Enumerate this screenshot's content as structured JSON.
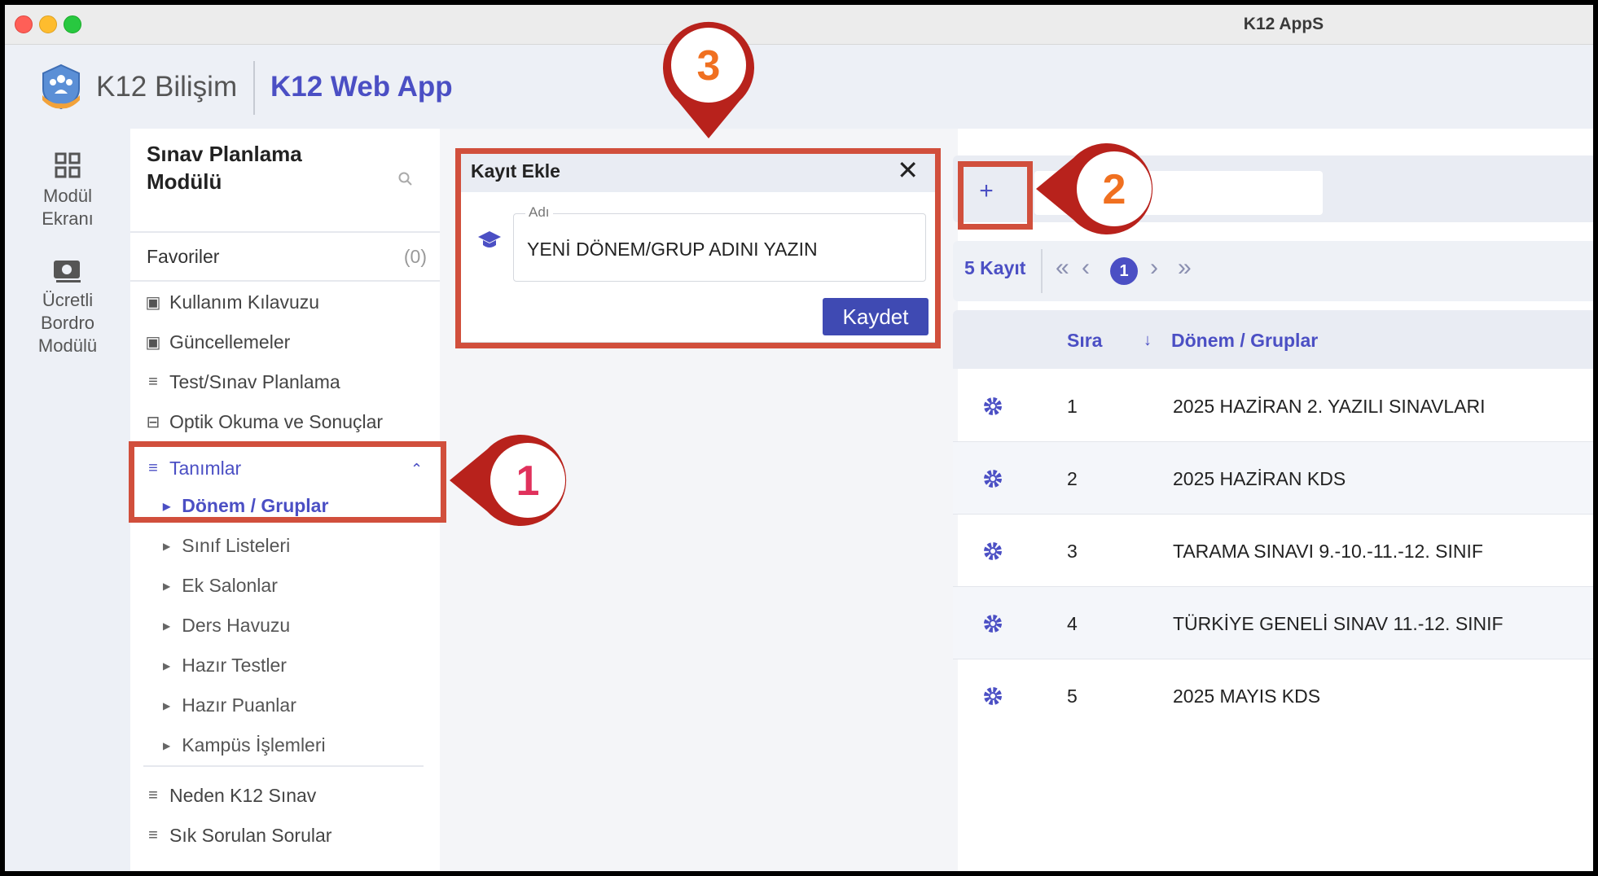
{
  "window": {
    "title": "K12 AppS"
  },
  "header": {
    "brand": "K12 Bilişim",
    "app_title": "K12 Web App"
  },
  "rail": {
    "items": [
      {
        "label_l1": "Modül",
        "label_l2": "Ekranı",
        "icon": "grid-icon"
      },
      {
        "label_l1": "Ücretli",
        "label_l2": "Bordro",
        "label_l3": "Modülü",
        "icon": "payroll-icon"
      }
    ]
  },
  "sidebar": {
    "module_title": "Sınav Planlama Modülü",
    "favorites_label": "Favoriler",
    "favorites_count": "(0)",
    "items": [
      {
        "label": "Kullanım Kılavuzu",
        "icon": "book-icon"
      },
      {
        "label": "Güncellemeler",
        "icon": "book-icon"
      },
      {
        "label": "Test/Sınav Planlama",
        "icon": "menu-icon"
      },
      {
        "label": "Optik Okuma ve Sonuçlar",
        "icon": "scanner-icon"
      },
      {
        "label": "Tanımlar",
        "icon": "list-add-icon"
      }
    ],
    "subitems": [
      "Dönem / Gruplar",
      "Sınıf Listeleri",
      "Ek Salonlar",
      "Ders Havuzu",
      "Hazır Testler",
      "Hazır Puanlar",
      "Kampüs İşlemleri"
    ],
    "bottom_items": [
      {
        "label": "Neden K12 Sınav",
        "icon": "menu-icon"
      },
      {
        "label": "Sık Sorulan Sorular",
        "icon": "menu-icon"
      }
    ]
  },
  "dialog": {
    "title": "Kayıt Ekle",
    "close": "✕",
    "field_label": "Adı",
    "field_value": "YENİ DÖNEM/GRUP ADINI YAZIN",
    "save_label": "Kaydet"
  },
  "toolbar": {
    "add_label": "+"
  },
  "pager": {
    "count_label": "5 Kayıt",
    "first": "«",
    "prev": "‹",
    "current_page": "1",
    "next": "›",
    "last": "»"
  },
  "table": {
    "headers": {
      "sira": "Sıra",
      "sort": "↓",
      "name": "Dönem / Gruplar"
    },
    "rows": [
      {
        "sira": "1",
        "name": "2025 HAZİRAN 2. YAZILI SINAVLARI"
      },
      {
        "sira": "2",
        "name": "2025 HAZİRAN KDS"
      },
      {
        "sira": "3",
        "name": "TARAMA SINAVI 9.-10.-11.-12. SINIF"
      },
      {
        "sira": "4",
        "name": "TÜRKİYE GENELİ SINAV 11.-12. SINIF"
      },
      {
        "sira": "5",
        "name": "2025 MAYIS KDS"
      }
    ]
  },
  "annotations": [
    {
      "number": "1",
      "color": "#e0315c"
    },
    {
      "number": "2",
      "color": "#f07020"
    },
    {
      "number": "3",
      "color": "#f07020"
    }
  ],
  "colors": {
    "accent": "#4b4fc4",
    "highlight": "#d14f3c",
    "pin": "#b8221c"
  }
}
